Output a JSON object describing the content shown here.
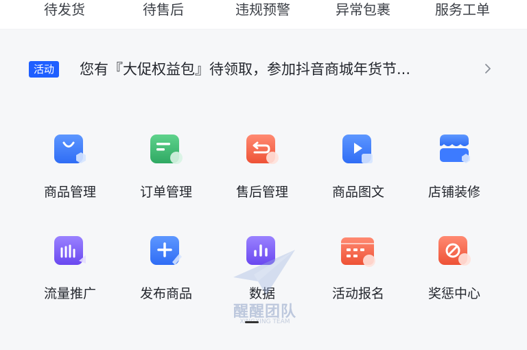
{
  "tabs": [
    "待发货",
    "待售后",
    "违规预警",
    "异常包裹",
    "服务工单"
  ],
  "notice": {
    "badge": "活动",
    "text": "您有『大促权益包』待领取，参加抖音商城年货节..."
  },
  "grid": [
    {
      "label": "商品管理",
      "icon": "shopping-bag-icon",
      "color": "#3d7bff"
    },
    {
      "label": "订单管理",
      "icon": "order-list-icon",
      "color": "#3cb770"
    },
    {
      "label": "售后管理",
      "icon": "return-icon",
      "color": "#f4604c"
    },
    {
      "label": "商品图文",
      "icon": "video-play-icon",
      "color": "#3d7bff"
    },
    {
      "label": "店铺装修",
      "icon": "storefront-icon",
      "color": "#3d7bff"
    },
    {
      "label": "流量推广",
      "icon": "traffic-icon",
      "color": "#7b5cff"
    },
    {
      "label": "发布商品",
      "icon": "plus-icon",
      "color": "#3d7bff"
    },
    {
      "label": "数据",
      "icon": "bar-chart-icon",
      "color": "#7b5cff"
    },
    {
      "label": "活动报名",
      "icon": "calendar-icon",
      "color": "#f4604c"
    },
    {
      "label": "奖惩中心",
      "icon": "prohibited-icon",
      "color": "#f4604c"
    }
  ],
  "watermark": {
    "title": "醒醒团队",
    "subtitle": "XINGXING TEAM"
  }
}
